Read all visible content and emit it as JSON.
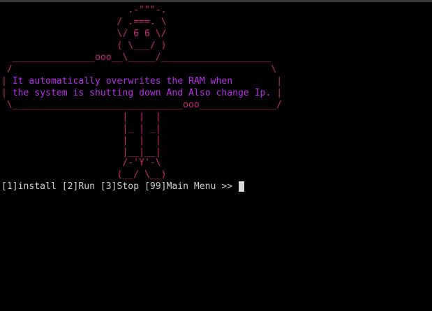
{
  "terminal": {
    "banner": {
      "lines": [
        ".-\"\"\"-.",
        "/ .===. \\",
        "\\/ 6 6 \\/",
        "( \\___/ )",
        "_______________ooo__\\_____/____________________",
        "/                                               \\",
        "|",
        "It automatically overwrites the RAM when",
        "|",
        "|",
        "the system is shutting down And Also change Ip.",
        "|",
        "\\_______________________________ooo______________/",
        "|  |  |",
        "|_ | _|",
        "|  |  |",
        "|__|__|",
        "/-'Y'-\\",
        "(__/ \\__)"
      ],
      "message_color": "#b830e6",
      "art_color": "#c8287a"
    },
    "prompt": {
      "options": "[1]install [2]Run [3]Stop [99]Main Menu >> ",
      "text_color": "#cfcfcf"
    }
  }
}
